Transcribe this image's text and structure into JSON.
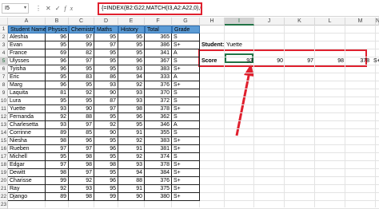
{
  "formula_bar": {
    "name_box": "I5",
    "icons": [
      "more-icon",
      "cancel-icon",
      "enter-icon",
      "fx-icon"
    ],
    "formula": "{=INDEX(B2:G22,MATCH(I3,A2:A22,0),0)}"
  },
  "columns": [
    "A",
    "B",
    "C",
    "D",
    "E",
    "F",
    "G",
    "H",
    "I",
    "J",
    "K",
    "L",
    "M",
    "N"
  ],
  "selected_column": "I",
  "selected_row": "5",
  "table": {
    "headers": [
      "Student Name",
      "Physics",
      "Chemistry",
      "Maths",
      "History",
      "Total",
      "Grade"
    ],
    "rows": [
      [
        "Aleshia",
        "96",
        "97",
        "95",
        "95",
        "365",
        "S"
      ],
      [
        "Evan",
        "95",
        "99",
        "97",
        "95",
        "386",
        "S+"
      ],
      [
        "France",
        "69",
        "82",
        "95",
        "95",
        "341",
        "A"
      ],
      [
        "Ulysses",
        "96",
        "97",
        "95",
        "96",
        "367",
        "S"
      ],
      [
        "Tyisha",
        "96",
        "95",
        "95",
        "93",
        "383",
        "S+"
      ],
      [
        "Eric",
        "95",
        "83",
        "86",
        "94",
        "333",
        "A"
      ],
      [
        "Marg",
        "96",
        "95",
        "93",
        "92",
        "376",
        "S+"
      ],
      [
        "Laquita",
        "81",
        "92",
        "90",
        "93",
        "370",
        "S"
      ],
      [
        "Lura",
        "95",
        "95",
        "87",
        "93",
        "372",
        "S"
      ],
      [
        "Yuette",
        "93",
        "90",
        "97",
        "98",
        "378",
        "S+"
      ],
      [
        "Fernanda",
        "92",
        "88",
        "95",
        "96",
        "362",
        "S"
      ],
      [
        "Charlesetta",
        "93",
        "97",
        "92",
        "95",
        "346",
        "A"
      ],
      [
        "Corrinne",
        "89",
        "85",
        "90",
        "91",
        "355",
        "S"
      ],
      [
        "Niesha",
        "98",
        "96",
        "95",
        "92",
        "383",
        "S+"
      ],
      [
        "Rueben",
        "97",
        "97",
        "96",
        "91",
        "381",
        "S+"
      ],
      [
        "Michell",
        "95",
        "98",
        "95",
        "92",
        "374",
        "S"
      ],
      [
        "Edgar",
        "97",
        "98",
        "98",
        "93",
        "378",
        "S+"
      ],
      [
        "Dewitt",
        "98",
        "97",
        "95",
        "94",
        "384",
        "S+"
      ],
      [
        "Charisse",
        "99",
        "92",
        "96",
        "88",
        "376",
        "S+"
      ],
      [
        "Ray",
        "92",
        "93",
        "95",
        "91",
        "375",
        "S+"
      ],
      [
        "Django",
        "89",
        "98",
        "99",
        "90",
        "380",
        "S+"
      ]
    ]
  },
  "lookup": {
    "student_label": "Student:",
    "student_value": "Yuette",
    "score_label": "Score",
    "score_values": [
      "93",
      "90",
      "97",
      "98",
      "378",
      "S+"
    ]
  },
  "colors": {
    "header_fill": "#5b9bd5",
    "highlight": "#e0202e",
    "selection": "#217346"
  }
}
